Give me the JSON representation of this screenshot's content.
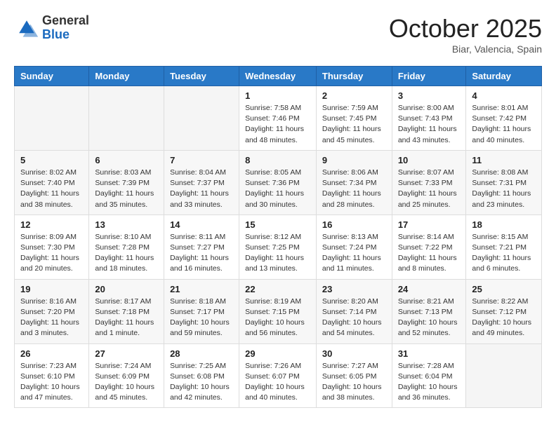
{
  "header": {
    "logo_general": "General",
    "logo_blue": "Blue",
    "month_title": "October 2025",
    "location": "Biar, Valencia, Spain"
  },
  "days_of_week": [
    "Sunday",
    "Monday",
    "Tuesday",
    "Wednesday",
    "Thursday",
    "Friday",
    "Saturday"
  ],
  "weeks": [
    {
      "shade": false,
      "days": [
        {
          "number": "",
          "sunrise": "",
          "sunset": "",
          "daylight": ""
        },
        {
          "number": "",
          "sunrise": "",
          "sunset": "",
          "daylight": ""
        },
        {
          "number": "",
          "sunrise": "",
          "sunset": "",
          "daylight": ""
        },
        {
          "number": "1",
          "sunrise": "Sunrise: 7:58 AM",
          "sunset": "Sunset: 7:46 PM",
          "daylight": "Daylight: 11 hours and 48 minutes."
        },
        {
          "number": "2",
          "sunrise": "Sunrise: 7:59 AM",
          "sunset": "Sunset: 7:45 PM",
          "daylight": "Daylight: 11 hours and 45 minutes."
        },
        {
          "number": "3",
          "sunrise": "Sunrise: 8:00 AM",
          "sunset": "Sunset: 7:43 PM",
          "daylight": "Daylight: 11 hours and 43 minutes."
        },
        {
          "number": "4",
          "sunrise": "Sunrise: 8:01 AM",
          "sunset": "Sunset: 7:42 PM",
          "daylight": "Daylight: 11 hours and 40 minutes."
        }
      ]
    },
    {
      "shade": true,
      "days": [
        {
          "number": "5",
          "sunrise": "Sunrise: 8:02 AM",
          "sunset": "Sunset: 7:40 PM",
          "daylight": "Daylight: 11 hours and 38 minutes."
        },
        {
          "number": "6",
          "sunrise": "Sunrise: 8:03 AM",
          "sunset": "Sunset: 7:39 PM",
          "daylight": "Daylight: 11 hours and 35 minutes."
        },
        {
          "number": "7",
          "sunrise": "Sunrise: 8:04 AM",
          "sunset": "Sunset: 7:37 PM",
          "daylight": "Daylight: 11 hours and 33 minutes."
        },
        {
          "number": "8",
          "sunrise": "Sunrise: 8:05 AM",
          "sunset": "Sunset: 7:36 PM",
          "daylight": "Daylight: 11 hours and 30 minutes."
        },
        {
          "number": "9",
          "sunrise": "Sunrise: 8:06 AM",
          "sunset": "Sunset: 7:34 PM",
          "daylight": "Daylight: 11 hours and 28 minutes."
        },
        {
          "number": "10",
          "sunrise": "Sunrise: 8:07 AM",
          "sunset": "Sunset: 7:33 PM",
          "daylight": "Daylight: 11 hours and 25 minutes."
        },
        {
          "number": "11",
          "sunrise": "Sunrise: 8:08 AM",
          "sunset": "Sunset: 7:31 PM",
          "daylight": "Daylight: 11 hours and 23 minutes."
        }
      ]
    },
    {
      "shade": false,
      "days": [
        {
          "number": "12",
          "sunrise": "Sunrise: 8:09 AM",
          "sunset": "Sunset: 7:30 PM",
          "daylight": "Daylight: 11 hours and 20 minutes."
        },
        {
          "number": "13",
          "sunrise": "Sunrise: 8:10 AM",
          "sunset": "Sunset: 7:28 PM",
          "daylight": "Daylight: 11 hours and 18 minutes."
        },
        {
          "number": "14",
          "sunrise": "Sunrise: 8:11 AM",
          "sunset": "Sunset: 7:27 PM",
          "daylight": "Daylight: 11 hours and 16 minutes."
        },
        {
          "number": "15",
          "sunrise": "Sunrise: 8:12 AM",
          "sunset": "Sunset: 7:25 PM",
          "daylight": "Daylight: 11 hours and 13 minutes."
        },
        {
          "number": "16",
          "sunrise": "Sunrise: 8:13 AM",
          "sunset": "Sunset: 7:24 PM",
          "daylight": "Daylight: 11 hours and 11 minutes."
        },
        {
          "number": "17",
          "sunrise": "Sunrise: 8:14 AM",
          "sunset": "Sunset: 7:22 PM",
          "daylight": "Daylight: 11 hours and 8 minutes."
        },
        {
          "number": "18",
          "sunrise": "Sunrise: 8:15 AM",
          "sunset": "Sunset: 7:21 PM",
          "daylight": "Daylight: 11 hours and 6 minutes."
        }
      ]
    },
    {
      "shade": true,
      "days": [
        {
          "number": "19",
          "sunrise": "Sunrise: 8:16 AM",
          "sunset": "Sunset: 7:20 PM",
          "daylight": "Daylight: 11 hours and 3 minutes."
        },
        {
          "number": "20",
          "sunrise": "Sunrise: 8:17 AM",
          "sunset": "Sunset: 7:18 PM",
          "daylight": "Daylight: 11 hours and 1 minute."
        },
        {
          "number": "21",
          "sunrise": "Sunrise: 8:18 AM",
          "sunset": "Sunset: 7:17 PM",
          "daylight": "Daylight: 10 hours and 59 minutes."
        },
        {
          "number": "22",
          "sunrise": "Sunrise: 8:19 AM",
          "sunset": "Sunset: 7:15 PM",
          "daylight": "Daylight: 10 hours and 56 minutes."
        },
        {
          "number": "23",
          "sunrise": "Sunrise: 8:20 AM",
          "sunset": "Sunset: 7:14 PM",
          "daylight": "Daylight: 10 hours and 54 minutes."
        },
        {
          "number": "24",
          "sunrise": "Sunrise: 8:21 AM",
          "sunset": "Sunset: 7:13 PM",
          "daylight": "Daylight: 10 hours and 52 minutes."
        },
        {
          "number": "25",
          "sunrise": "Sunrise: 8:22 AM",
          "sunset": "Sunset: 7:12 PM",
          "daylight": "Daylight: 10 hours and 49 minutes."
        }
      ]
    },
    {
      "shade": false,
      "days": [
        {
          "number": "26",
          "sunrise": "Sunrise: 7:23 AM",
          "sunset": "Sunset: 6:10 PM",
          "daylight": "Daylight: 10 hours and 47 minutes."
        },
        {
          "number": "27",
          "sunrise": "Sunrise: 7:24 AM",
          "sunset": "Sunset: 6:09 PM",
          "daylight": "Daylight: 10 hours and 45 minutes."
        },
        {
          "number": "28",
          "sunrise": "Sunrise: 7:25 AM",
          "sunset": "Sunset: 6:08 PM",
          "daylight": "Daylight: 10 hours and 42 minutes."
        },
        {
          "number": "29",
          "sunrise": "Sunrise: 7:26 AM",
          "sunset": "Sunset: 6:07 PM",
          "daylight": "Daylight: 10 hours and 40 minutes."
        },
        {
          "number": "30",
          "sunrise": "Sunrise: 7:27 AM",
          "sunset": "Sunset: 6:05 PM",
          "daylight": "Daylight: 10 hours and 38 minutes."
        },
        {
          "number": "31",
          "sunrise": "Sunrise: 7:28 AM",
          "sunset": "Sunset: 6:04 PM",
          "daylight": "Daylight: 10 hours and 36 minutes."
        },
        {
          "number": "",
          "sunrise": "",
          "sunset": "",
          "daylight": ""
        }
      ]
    }
  ]
}
